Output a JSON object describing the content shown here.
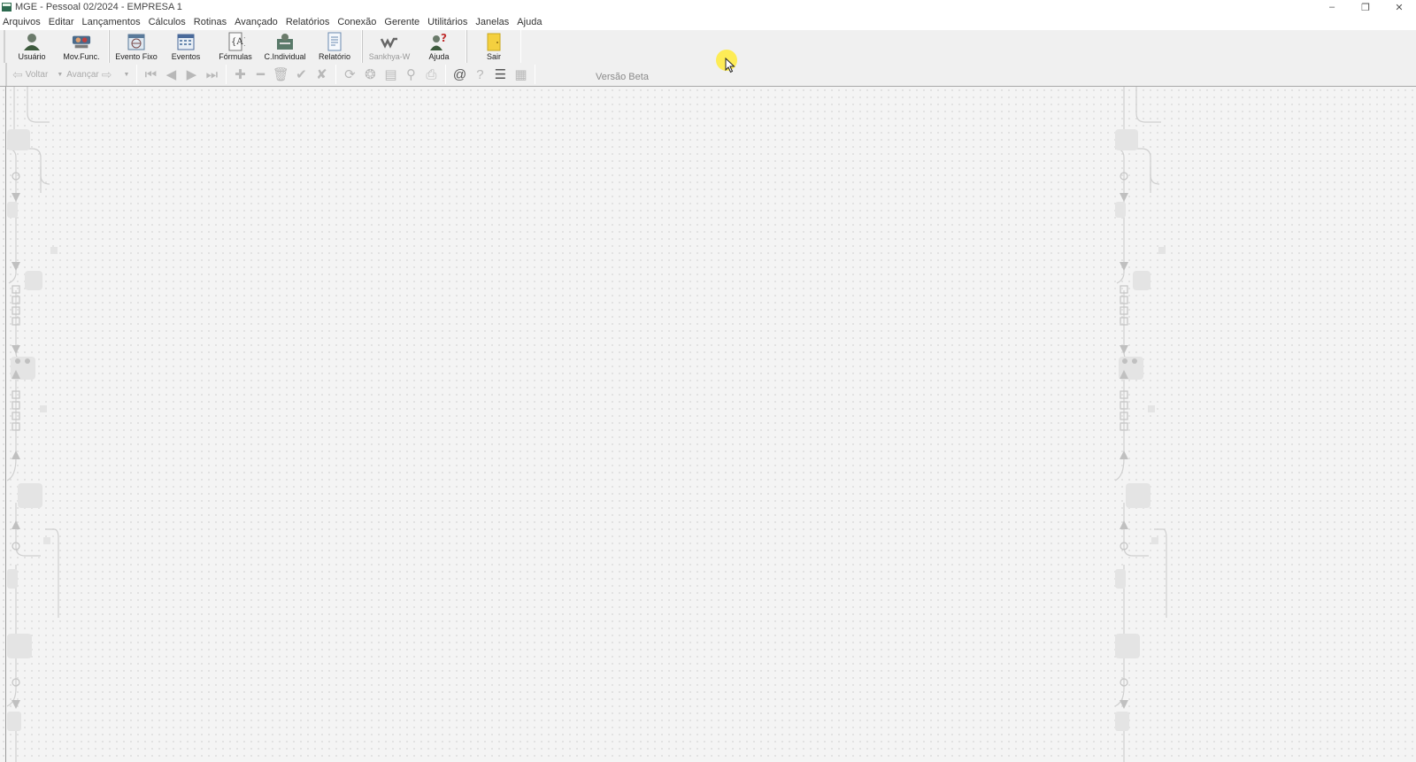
{
  "window": {
    "title": "MGE - Pessoal 02/2024 - EMPRESA 1",
    "controls": {
      "minimize": "–",
      "restore": "❐",
      "close": "✕"
    }
  },
  "menu": [
    {
      "label": "Arquivos"
    },
    {
      "label": "Editar"
    },
    {
      "label": "Lançamentos"
    },
    {
      "label": "Cálculos"
    },
    {
      "label": "Rotinas"
    },
    {
      "label": "Avançado"
    },
    {
      "label": "Relatórios"
    },
    {
      "label": "Conexão"
    },
    {
      "label": "Gerente"
    },
    {
      "label": "Utilitários"
    },
    {
      "label": "Janelas"
    },
    {
      "label": "Ajuda"
    }
  ],
  "toolbar": {
    "usuario": "Usuário",
    "mov_func": "Mov.Func.",
    "evento_fixo": "Evento Fixo",
    "eventos": "Eventos",
    "formulas": "Fórmulas",
    "c_individual": "C.Individual",
    "relatorio": "Relatório",
    "sankhya": "Sankhya-W",
    "ajuda": "Ajuda",
    "sair": "Sair"
  },
  "nav": {
    "voltar": "Voltar",
    "avancar": "Avançar"
  },
  "beta_label": "Versão Beta",
  "colors": {
    "workspace": "#f4f4f4",
    "toolbar": "#f0f0f0",
    "cursor_highlight": "#ffeb3b"
  }
}
